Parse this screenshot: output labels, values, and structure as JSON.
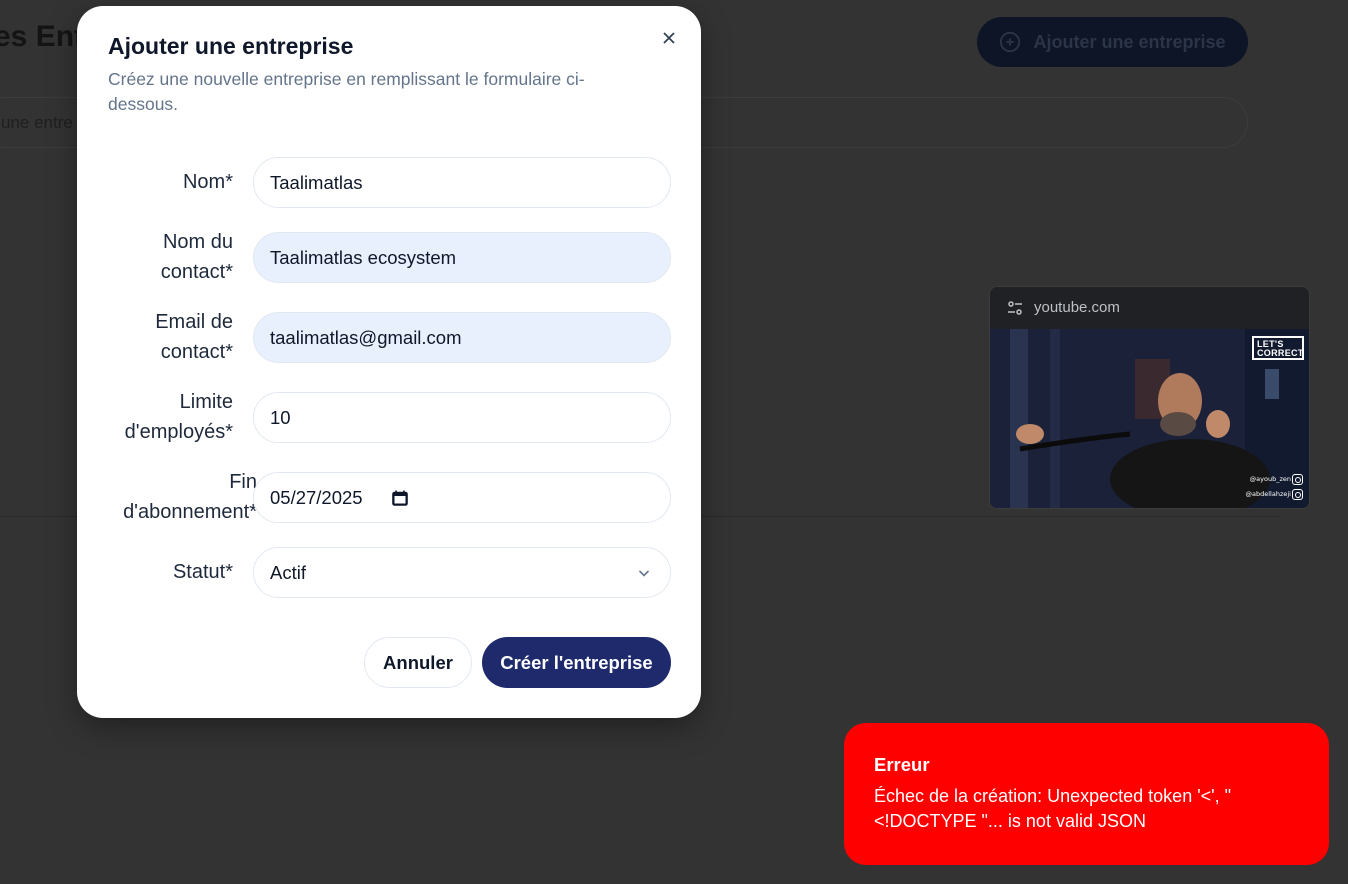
{
  "background": {
    "title": "es Entr",
    "add_button_label": "Ajouter une entreprise",
    "search_placeholder": "une entre"
  },
  "modal": {
    "title": "Ajouter une entreprise",
    "description": "Créez une nouvelle entreprise en remplissant le formulaire ci-dessous.",
    "fields": {
      "nom": {
        "label": "Nom*",
        "value": "Taalimatlas"
      },
      "contact_name": {
        "label": "Nom du contact*",
        "value": "Taalimatlas ecosystem"
      },
      "contact_email": {
        "label": "Email de contact*",
        "value": "taalimatlas@gmail.com"
      },
      "employee_limit": {
        "label": "Limite d'employés*",
        "value": "10"
      },
      "subscription_end": {
        "label": "Fin d'abonnement*",
        "value": "05/27/2025"
      },
      "status": {
        "label": "Statut*",
        "value": "Actif"
      }
    },
    "cancel_label": "Annuler",
    "create_label": "Créer l'entreprise"
  },
  "pip": {
    "domain": "youtube.com",
    "badge": "LET'S CORRECT",
    "handle_1": "@ayoub_zen",
    "handle_2": "@abdellahzeji"
  },
  "toast": {
    "title": "Erreur",
    "message": "Échec de la création: Unexpected token '<', \"<!DOCTYPE \"... is not valid JSON"
  },
  "colors": {
    "overlay": "#333333",
    "primary": "#1e2a6b",
    "error": "#ff0000",
    "autofill": "#e8f0fe"
  }
}
